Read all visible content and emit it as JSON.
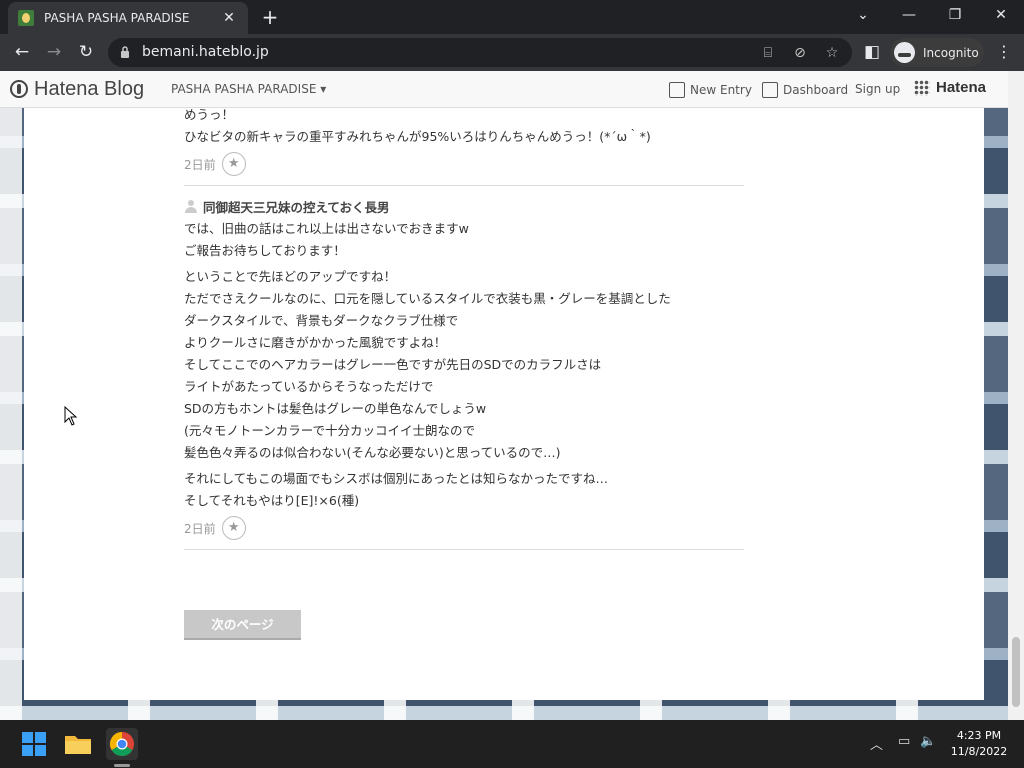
{
  "browser": {
    "tab_title": "PASHA PASHA PARADISE",
    "url": "bemani.hateblo.jp",
    "incognito_label": "Incognito"
  },
  "hatena_header": {
    "logo_text": "Hatena Blog",
    "blog_name": "PASHA PASHA PARADISE ▾",
    "new_entry": "New Entry",
    "dashboard": "Dashboard",
    "sign_up": "Sign up",
    "hatena": "Hatena"
  },
  "comments": [
    {
      "lines": [
        "めうっ！",
        "ひなビタの新キャラの重平すみれちゃんが95%いろはりんちゃんめうっ！(*´ω｀*)"
      ],
      "date": "2日前"
    },
    {
      "author": "同御超天三兄妹の控えておく長男",
      "paragraphs": [
        [
          "では、旧曲の話はこれ以上は出さないでおきますw",
          "ご報告お待ちしております！"
        ],
        [
          "ということで先ほどのアップですね！",
          "ただでさえクールなのに、口元を隠しているスタイルで衣装も黒・グレーを基調とした",
          "ダークスタイルで、背景もダークなクラブ仕様で",
          "よりクールさに磨きがかかった風貌ですよね！",
          "そしてここでのヘアカラーはグレー一色ですが先日のSDでのカラフルさは",
          "ライトがあたっているからそうなっただけで",
          "SDの方もホントは髪色はグレーの単色なんでしょうw",
          "(元々モノトーンカラーで十分カッコイイ士朗なので",
          "髪色色々弄るのは似合わない(そんな必要ない)と思っているので…)"
        ],
        [
          "それにしてもこの場面でもシスボは個別にあったとは知らなかったですね…",
          "そしてそれもやはり[E]!×6(種)"
        ]
      ],
      "date": "2日前"
    }
  ],
  "next_page_label": "次のページ",
  "taskbar": {
    "time": "4:23 PM",
    "date": "11/8/2022"
  },
  "colors": {
    "chrome_dark": "#202124",
    "chrome_toolbar": "#35363a",
    "page_bg": "#ffffff",
    "pattern_navy": "#41546d"
  }
}
